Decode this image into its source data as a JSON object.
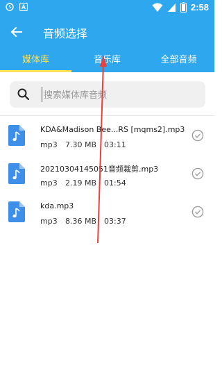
{
  "status_bar": {
    "time": "2:58",
    "icons_left": [
      "clock-icon",
      "a-letter-icon"
    ],
    "icons_right": [
      "wifi-icon",
      "signal-icon",
      "battery-icon"
    ]
  },
  "toolbar": {
    "title": "音频选择",
    "back_icon": "arrow-left-icon"
  },
  "tabs": [
    {
      "label": "媒体库",
      "active": true
    },
    {
      "label": "音乐库",
      "active": false
    },
    {
      "label": "全部音频",
      "active": false
    }
  ],
  "search": {
    "placeholder": "搜索媒体库音频",
    "value": ""
  },
  "files": [
    {
      "name": "KDA&Madison Bee...RS [mqms2].mp3",
      "type": "mp3",
      "size": "7.30 MB",
      "duration": "03:11"
    },
    {
      "name": "20210304145051音频裁剪.mp3",
      "type": "mp3",
      "size": "2.19 MB",
      "duration": "01:54"
    },
    {
      "name": "kda.mp3",
      "type": "mp3",
      "size": "8.36 MB",
      "duration": "03:37"
    }
  ],
  "colors": {
    "primary": "#2ea7ef",
    "tab_active": "#ffe15a",
    "arrow": "#e8413b"
  }
}
